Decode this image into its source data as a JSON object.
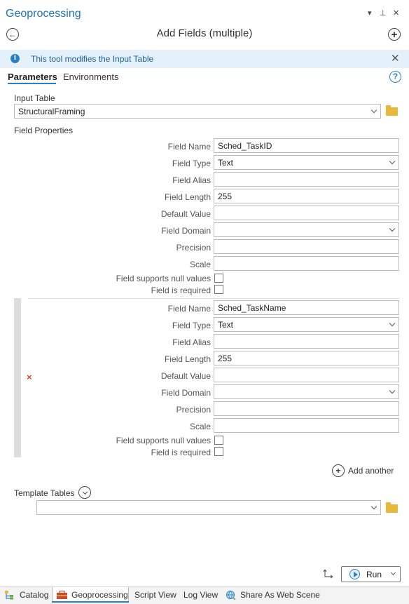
{
  "pane": {
    "title": "Geoprocessing",
    "menu_glyph": "▾",
    "pin_glyph": "⊥",
    "close_glyph": "✕"
  },
  "tool": {
    "title": "Add Fields (multiple)",
    "back_glyph": "←",
    "add_glyph": "+"
  },
  "banner": {
    "info_glyph": "i",
    "message": "This tool modifies the Input Table",
    "close_glyph": "✕"
  },
  "tabs": {
    "parameters": "Parameters",
    "environments": "Environments",
    "help_glyph": "?"
  },
  "input_table": {
    "label": "Input Table",
    "value": "StructuralFraming"
  },
  "field_properties": {
    "label": "Field Properties",
    "labels": {
      "field_name": "Field Name",
      "field_type": "Field Type",
      "field_alias": "Field Alias",
      "field_length": "Field Length",
      "default_value": "Default Value",
      "field_domain": "Field Domain",
      "precision": "Precision",
      "scale": "Scale",
      "null_values": "Field supports null values",
      "required": "Field is required"
    },
    "fields": [
      {
        "field_name": "Sched_TaskID",
        "field_type": "Text",
        "field_alias": "",
        "field_length": "255",
        "default_value": "",
        "field_domain": "",
        "precision": "",
        "scale": ""
      },
      {
        "field_name": "Sched_TaskName",
        "field_type": "Text",
        "field_alias": "",
        "field_length": "255",
        "default_value": "",
        "field_domain": "",
        "precision": "",
        "scale": ""
      }
    ],
    "remove_glyph": "×",
    "add_another": "Add another"
  },
  "template_tables": {
    "label": "Template Tables",
    "value": ""
  },
  "run": {
    "label": "Run"
  },
  "bottom_tabs": [
    "Catalog",
    "Geoprocessing",
    "Script View",
    "Log View",
    "Share As Web Scene"
  ],
  "colors": {
    "accent": "#2a80c5",
    "title": "#2073b8",
    "banner_bg": "#e4f1fa",
    "remove": "#c8502e",
    "folder": "#e8b83a"
  }
}
